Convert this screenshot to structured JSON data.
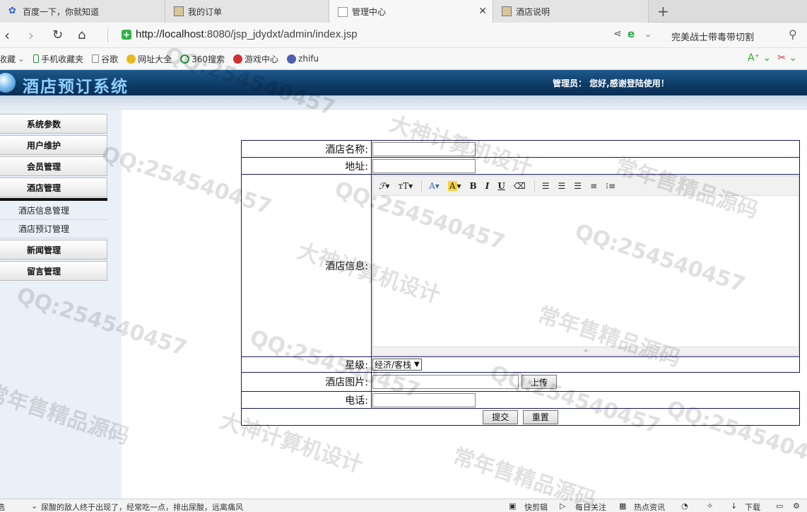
{
  "browser": {
    "tabs": [
      {
        "label": "百度一下，你就知道"
      },
      {
        "label": "我的订单"
      },
      {
        "label": "管理中心"
      },
      {
        "label": "酒店说明"
      }
    ],
    "url_host": "http://localhost",
    "url_path": ":8080/jsp_jdydxt/admin/index.jsp",
    "news_text": "完美战士带毒带切割",
    "bookmarks": [
      "收藏",
      "手机收藏夹",
      "谷歌",
      "网址大全",
      "360搜索",
      "游戏中心",
      "zhifu"
    ]
  },
  "header": {
    "title": "酒店预订系统",
    "admin_text": "管理员： 您好,感谢登陆使用！"
  },
  "sidebar": {
    "menu": [
      {
        "label": "系统参数"
      },
      {
        "label": "用户维护"
      },
      {
        "label": "会员管理"
      },
      {
        "label": "酒店管理"
      }
    ],
    "submenu": [
      {
        "label": "酒店信息管理"
      },
      {
        "label": "酒店预订管理"
      }
    ],
    "menu_after": [
      {
        "label": "新闻管理"
      },
      {
        "label": "留言管理"
      }
    ]
  },
  "form": {
    "name_label": "酒店名称:",
    "address_label": "地址:",
    "info_label": "酒店信息:",
    "star_label": "星级:",
    "star_value": "经济/客栈",
    "image_label": "酒店图片:",
    "upload_label": "上传",
    "phone_label": "电话:",
    "submit_label": "提交",
    "reset_label": "重置"
  },
  "statusbar": {
    "left_text": "尿酸的敌人终于出现了，经常吃一点，排出尿酸，远离痛风",
    "items": [
      "快剪辑",
      "每日关注",
      "热点资讯",
      "下载"
    ]
  },
  "watermarks": [
    "QQ:254540457",
    "常年售精品源码",
    "大神计算机设计"
  ]
}
